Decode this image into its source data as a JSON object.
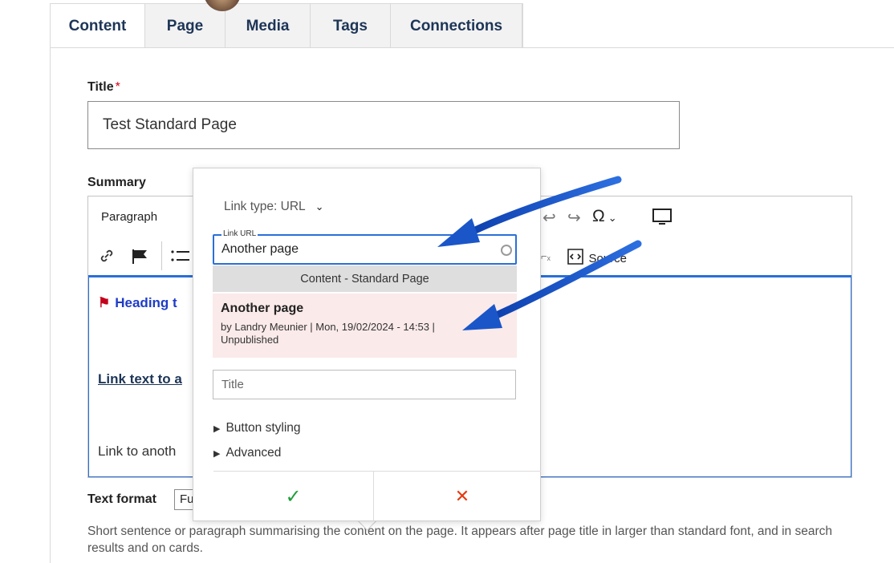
{
  "tabs": [
    "Content",
    "Page",
    "Media",
    "Tags",
    "Connections"
  ],
  "form": {
    "title_label": "Title",
    "required_mark": "*",
    "title_value": "Test Standard Page",
    "summary_label": "Summary"
  },
  "toolbar": {
    "paragraph": "Paragraph",
    "source": "Source"
  },
  "editor": {
    "heading": "Heading t",
    "link_text": "Link text to a",
    "plain_text": "Link to anoth"
  },
  "text_format": {
    "label": "Text format",
    "value": "Fu"
  },
  "help_text": "Short sentence or paragraph summarising the content on the page. It appears after page title in larger than standard font, and in search results and on cards.",
  "link_popup": {
    "link_type": "Link type: URL",
    "url_legend": "Link URL",
    "url_value": "Another page",
    "autocomplete_header": "Content - Standard Page",
    "result_title": "Another page",
    "result_meta_1": "by Landry Meunier | Mon, 19/02/2024 - 14:53 |",
    "result_meta_2": "Unpublished",
    "title_placeholder": "Title",
    "button_styling": "Button styling",
    "advanced": "Advanced",
    "ok_symbol": "✓",
    "cancel_symbol": "✕"
  },
  "colors": {
    "accent": "#2a6fd8",
    "arrow": "#1a56c8",
    "ok": "#1e9e3a",
    "cancel": "#e33b14",
    "link": "#1d3557"
  },
  "icons": [
    "link-icon",
    "flag-icon",
    "bullet-list-icon",
    "undo-icon",
    "redo-icon",
    "omega-icon",
    "fullscreen-icon",
    "remove-format-icon",
    "source-icon",
    "spinner-icon"
  ]
}
